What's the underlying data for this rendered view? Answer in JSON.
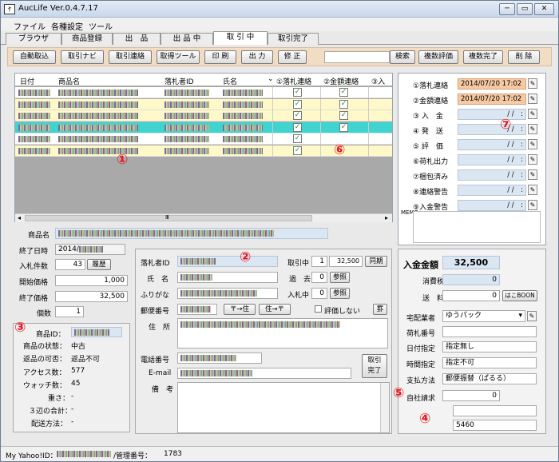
{
  "window": {
    "title": "AucLife Ver.0.4.7.17",
    "icon_text": "ﾔ",
    "min": "─",
    "max": "▭",
    "close": "✕"
  },
  "menu": [
    "ファイル",
    "各種設定",
    "ツール"
  ],
  "tabs": [
    "ブラウザ",
    "商品登録",
    "出　品",
    "出 品 中",
    "取 引 中",
    "取引完了"
  ],
  "toolbar": {
    "buttons": [
      "自動取込",
      "取引ナビ",
      "取引連絡",
      "取得ツール",
      "印 刷",
      "出 力",
      "修 正"
    ],
    "search_label": "検索",
    "right_buttons": [
      "複数評価",
      "複数完了",
      "削 除"
    ]
  },
  "grid": {
    "headers": [
      "日付",
      "商品名",
      "落札者ID",
      "氏名",
      "①落札連絡",
      "②金額連絡",
      "③入"
    ],
    "scroll_label": "Ⅲ"
  },
  "status_panel": {
    "rows": [
      {
        "label": "①落札連絡",
        "value": "2014/07/20 17:02"
      },
      {
        "label": "②金額連絡",
        "value": "2014/07/20 17:02"
      },
      {
        "label": "③ 入　金",
        "value": "/ /　:"
      },
      {
        "label": "④ 発　送",
        "value": "/ /　:"
      },
      {
        "label": "⑤ 評　価",
        "value": "/ /　:"
      },
      {
        "label": "⑥荷札出力",
        "value": "/ /　:"
      },
      {
        "label": "⑦梱包済み",
        "value": "/ /　:"
      },
      {
        "label": "⑧連絡警告",
        "value": "/ /　:"
      },
      {
        "label": "⑨入金警告",
        "value": "/ /　:"
      }
    ],
    "memo_label": "MEMO"
  },
  "item": {
    "name_label": "商品名",
    "end_label": "終了日時",
    "end_value": "2014/",
    "bids_label": "入札件数",
    "bids_value": "43",
    "history_btn": "履歴",
    "start_label": "開始価格",
    "start_value": "1,000",
    "final_label": "終了価格",
    "final_value": "32,500",
    "qty_label": "個数",
    "qty_value": "1"
  },
  "details": {
    "id_label": "商品ID：",
    "cond_label": "商品の状態：",
    "cond_value": "中古",
    "return_label": "返品の可否：",
    "return_value": "返品不可",
    "access_label": "アクセス数：",
    "access_value": "577",
    "watch_label": "ウォッチ数：",
    "watch_value": "45",
    "weight_label": "重さ：",
    "weight_value": "-",
    "size_label": "３辺の合計：",
    "size_value": "-",
    "ship_label": "配送方法：",
    "ship_value": "-"
  },
  "buyer": {
    "id_label": "落札者ID",
    "dealing_label": "取引中",
    "dealing_count": "1",
    "dealing_amount": "32,500",
    "same_btn": "同期",
    "name_label": "氏　名",
    "past_label": "過　去",
    "past_count": "0",
    "ref1": "参照",
    "kana_label": "ふりがな",
    "bidding_label": "入札中",
    "bidding_count": "0",
    "ref2": "参照",
    "zip_label": "郵便番号",
    "zip_btn1": "〒→住",
    "zip_btn2": "住→〒",
    "noeval_label": "評価しない",
    "rule_btn": "罫",
    "addr_label": "住　所",
    "tel_label": "電話番号",
    "email_label": "E-mail",
    "done_btn": "取引\n完了",
    "note_label": "備　考"
  },
  "payment": {
    "total_label": "入金金額",
    "total_value": "32,500",
    "tax_label": "消費税",
    "tax_value": "0",
    "shipping_label": "送　料",
    "shipping_value": "0",
    "shipping_btn": "はこBOON",
    "carrier_label": "宅配業者",
    "carrier_value": "ゆうパック",
    "tracking_label": "荷札番号",
    "date_label": "日付指定",
    "date_value": "指定無し",
    "time_label": "時間指定",
    "time_value": "指定不可",
    "method_label": "支払方法",
    "method_value": "郵便振替（ぱるる）",
    "own_label": "自社請求",
    "own_value": "0",
    "extra_value": "5460"
  },
  "status": {
    "yahoo_label": "My Yahoo!ID：",
    "mgmt_label": "/管理番号：",
    "mgmt_value": "1783"
  },
  "annotations": [
    "①",
    "②",
    "③",
    "④",
    "⑤",
    "⑥",
    "⑦"
  ]
}
